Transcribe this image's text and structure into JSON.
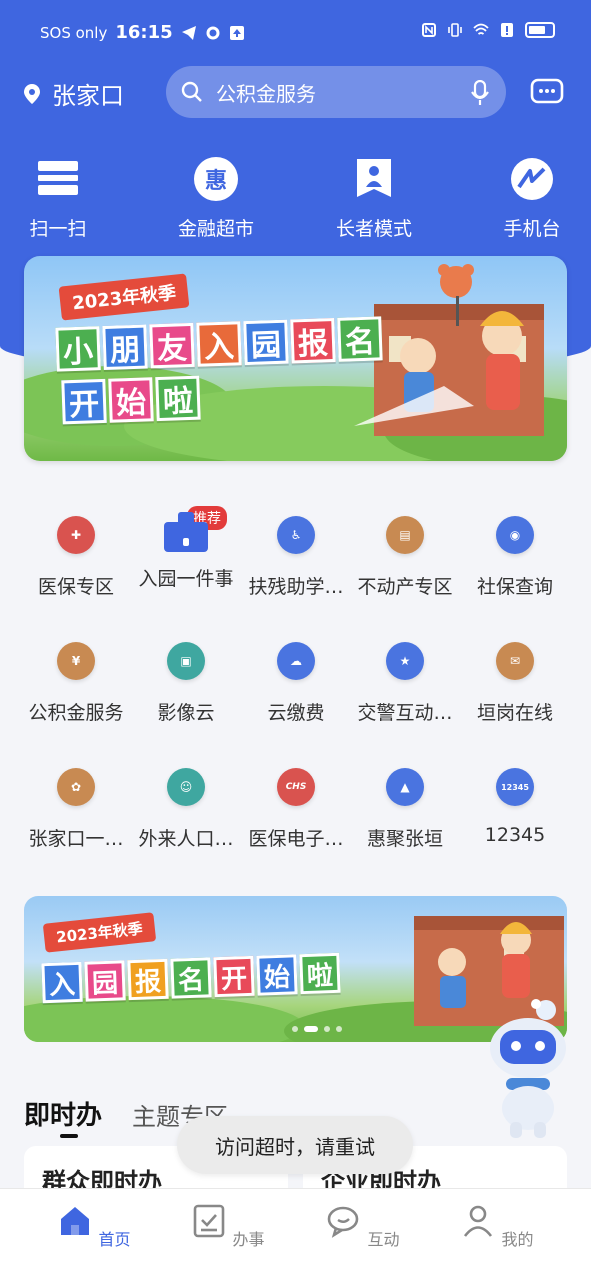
{
  "status_bar": {
    "carrier": "SOS only",
    "time": "16:15"
  },
  "header": {
    "location": "张家口",
    "search_placeholder": "公积金服务"
  },
  "quick_actions": [
    {
      "label": "扫一扫",
      "icon": "scan-icon"
    },
    {
      "label": "金融超市",
      "icon": "hui-finance-icon",
      "glyph": "惠"
    },
    {
      "label": "长者模式",
      "icon": "elder-mode-icon"
    },
    {
      "label": "手机台",
      "icon": "mobile-tv-icon"
    }
  ],
  "banner1": {
    "tag": "2023年秋季",
    "line1": [
      "小",
      "朋",
      "友",
      "入",
      "园",
      "报",
      "名"
    ],
    "line2": [
      "开",
      "始",
      "啦"
    ]
  },
  "services": [
    {
      "label": "医保专区",
      "icon": "medical-insurance-icon",
      "color": "#d9534f"
    },
    {
      "label": "入园一件事",
      "icon": "kindergarten-icon",
      "color": "#3f66e0",
      "badge": "推荐"
    },
    {
      "label": "扶残助学…",
      "icon": "disability-aid-icon",
      "color": "#4a74e0"
    },
    {
      "label": "不动产专区",
      "icon": "real-estate-icon",
      "color": "#c88a52"
    },
    {
      "label": "社保查询",
      "icon": "social-security-icon",
      "color": "#4a74e0"
    },
    {
      "label": "公积金服务",
      "icon": "housing-fund-icon",
      "color": "#c88a52",
      "glyph": "¥"
    },
    {
      "label": "影像云",
      "icon": "imaging-cloud-icon",
      "color": "#3fa7a0"
    },
    {
      "label": "云缴费",
      "icon": "cloud-payment-icon",
      "color": "#4a74e0"
    },
    {
      "label": "交警互动…",
      "icon": "traffic-police-icon",
      "color": "#4a74e0"
    },
    {
      "label": "垣岗在线",
      "icon": "yuangang-online-icon",
      "color": "#c88a52"
    },
    {
      "label": "张家口一…",
      "icon": "zjk-one-icon",
      "color": "#c88a52"
    },
    {
      "label": "外来人口…",
      "icon": "migrant-population-icon",
      "color": "#3fa7a0"
    },
    {
      "label": "医保电子…",
      "icon": "medical-ecard-icon",
      "color": "#d9534f",
      "glyph": "CHS"
    },
    {
      "label": "惠聚张垣",
      "icon": "huiju-zhangyuan-icon",
      "color": "#4a74e0"
    },
    {
      "label": "12345",
      "icon": "hotline-12345-icon",
      "color": "#4a74e0",
      "glyph": "12345"
    }
  ],
  "banner2": {
    "tag": "2023年秋季",
    "line": [
      "入",
      "园",
      "报",
      "名",
      "开",
      "始",
      "啦"
    ]
  },
  "section_tabs": [
    {
      "label": "即时办"
    },
    {
      "label": "主题专区"
    }
  ],
  "cards": [
    {
      "label": "群众即时办"
    },
    {
      "label": "企业即时办"
    }
  ],
  "toast": "访问超时，请重试",
  "bottom_nav": [
    {
      "label": "首页",
      "icon": "home-icon",
      "active": true
    },
    {
      "label": "办事",
      "icon": "tasks-icon"
    },
    {
      "label": "互动",
      "icon": "chat-icon"
    },
    {
      "label": "我的",
      "icon": "profile-icon"
    }
  ],
  "colors": {
    "primary": "#3f66e0",
    "badge_red": "#e23b3b"
  }
}
